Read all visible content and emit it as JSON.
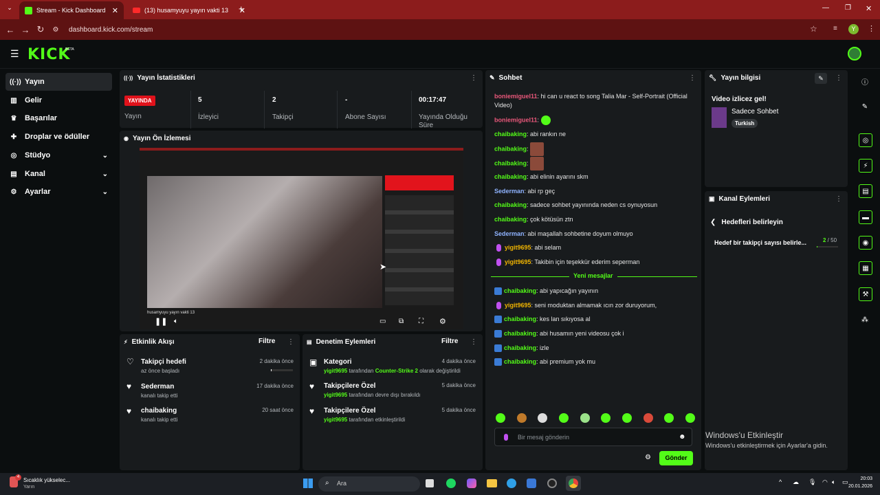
{
  "browser": {
    "tab1": "Stream - Kick Dashboard",
    "tab2": "(13) husamyuyu yayın vakti 13",
    "url": "dashboard.kick.com/stream",
    "profile_initial": "Y"
  },
  "logo": "KICK",
  "logo_badge": "BETA",
  "sidebar": {
    "items": [
      {
        "label": "Yayın",
        "icon": "broadcast-icon"
      },
      {
        "label": "Gelir",
        "icon": "revenue-icon"
      },
      {
        "label": "Başarılar",
        "icon": "trophy-icon"
      },
      {
        "label": "Droplar ve ödüller",
        "icon": "drops-icon"
      },
      {
        "label": "Stüdyo",
        "icon": "studio-icon"
      },
      {
        "label": "Kanal",
        "icon": "channel-icon"
      },
      {
        "label": "Ayarlar",
        "icon": "settings-icon"
      }
    ]
  },
  "stats": {
    "title": "Yayın İstatistikleri",
    "live_badge": "YAYINDA",
    "live_label": "Yayın",
    "viewers_value": "5",
    "viewers_label": "İzleyici",
    "followers_value": "2",
    "followers_label": "Takipçi",
    "subs_value": "-",
    "subs_label": "Abone Sayısı",
    "uptime_value": "00:17:47",
    "uptime_label": "Yayında Olduğu Süre"
  },
  "preview": {
    "title": "Yayın Ön İzlemesi",
    "video_caption": "husamyuyu yayın vakti 13"
  },
  "activity": {
    "title": "Etkinlik Akışı",
    "filter": "Filtre",
    "items": [
      {
        "title": "Takipçi hedefi",
        "sub": "az önce başladı",
        "time": "2 dakika önce"
      },
      {
        "title": "Sederman",
        "sub": "kanalı takip etti",
        "time": "17 dakika önce"
      },
      {
        "title": "chaibaking",
        "sub": "kanalı takip etti",
        "time": "20 saat önce"
      }
    ],
    "goal_progress": 0.04
  },
  "moderation": {
    "title": "Denetim Eylemleri",
    "filter": "Filtre",
    "items": [
      {
        "title": "Kategori",
        "user": "yigit9695",
        "mid": " tarafından ",
        "highlight": "Counter-Strike 2",
        "tail": " olarak değiştirildi",
        "time": "4 dakika önce"
      },
      {
        "title": "Takipçilere Özel",
        "user": "yigit9695",
        "mid": " tarafından devre dışı bırakıldı",
        "highlight": "",
        "tail": "",
        "time": "5 dakika önce"
      },
      {
        "title": "Takipçilere Özel",
        "user": "yigit9695",
        "mid": " tarafından etkinleştirildi",
        "highlight": "",
        "tail": "",
        "time": "5 dakika önce"
      }
    ]
  },
  "chat": {
    "title": "Sohbet",
    "messages": [
      {
        "user": "boniemiguel11",
        "text": "hi can u react to song Talia Mar - Self-Portrait (Official Video)",
        "color": "#e8577a"
      },
      {
        "user": "boniemiguel11",
        "text": "",
        "color": "#e8577a"
      },
      {
        "user": "chaibaking",
        "text": "abi rankın ne",
        "color": "#53fc18"
      },
      {
        "user": "chaibaking",
        "text": "",
        "color": "#53fc18"
      },
      {
        "user": "chaibaking",
        "text": "",
        "color": "#53fc18"
      },
      {
        "user": "chaibaking",
        "text": "abi elinin ayarını skm",
        "color": "#53fc18"
      },
      {
        "user": "Sederman",
        "text": "abi rp geç",
        "color": "#8fb3ff"
      },
      {
        "user": "chaibaking",
        "text": "sadece sohbet yayınında neden cs oynuyosun",
        "color": "#53fc18"
      },
      {
        "user": "chaibaking",
        "text": "çok kötüsün ztn",
        "color": "#53fc18"
      },
      {
        "user": "Sederman",
        "text": "abi maşallah sohbetine doyum olmuyo",
        "color": "#8fb3ff"
      },
      {
        "user": "yigit9695",
        "text": "abi selam",
        "color": "#f0b400"
      },
      {
        "user": "yigit9695",
        "text": "Takibin için teşekkür ederim seperman",
        "color": "#f0b400"
      },
      {
        "user": "chaibaking",
        "text": "abi yapıcağın yayının",
        "color": "#53fc18"
      },
      {
        "user": "yigit9695",
        "text": "seni moduktan almamak ıcın zor duruyorum,",
        "color": "#f0b400"
      },
      {
        "user": "chaibaking",
        "text": "kes lan sıkıyosa al",
        "color": "#53fc18"
      },
      {
        "user": "chaibaking",
        "text": "abi husamın yeni videosu çok i",
        "color": "#53fc18"
      },
      {
        "user": "chaibaking",
        "text": "izle",
        "color": "#53fc18"
      },
      {
        "user": "chaibaking",
        "text": "abi premium yok mu",
        "color": "#53fc18"
      }
    ],
    "new_messages": "Yeni mesajlar",
    "input_placeholder": "Bir mesaj gönderin",
    "send": "Gönder"
  },
  "stream_info": {
    "title": "Yayın bilgisi",
    "stream_title": "Video izlicez gel!",
    "category": "Sadece Sohbet",
    "tag": "Turkish"
  },
  "channel_actions": {
    "title": "Kanal Eylemleri",
    "back_label": "Hedefleri belirleyin",
    "goal_label": "Hedef bir takipçi sayısı belirle...",
    "goal_current": "2",
    "goal_sep": " / ",
    "goal_total": "50"
  },
  "watermark": {
    "line1": "Windows'u Etkinleştir",
    "line2": "Windows'u etkinleştirmek için Ayarlar'a gidin."
  },
  "taskbar": {
    "weather_title": "Sıcaklık yükselec...",
    "weather_sub": "Yarın",
    "weather_badge": "4",
    "search": "Ara",
    "time": "20:03",
    "date": "20.01.2026"
  }
}
